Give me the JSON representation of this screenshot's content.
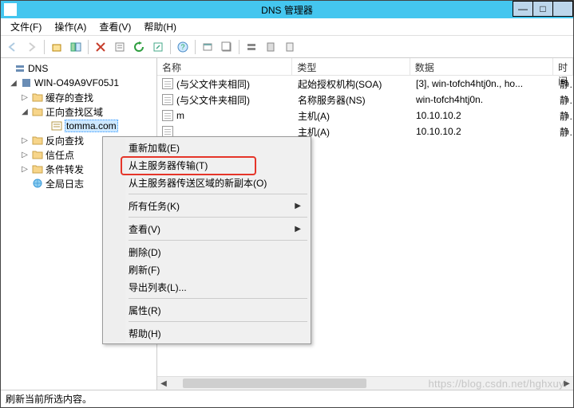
{
  "window": {
    "title": "DNS 管理器",
    "controls": {
      "min": "—",
      "max": "□",
      "close": ""
    }
  },
  "menu": {
    "file": "文件(F)",
    "action": "操作(A)",
    "view": "查看(V)",
    "help": "帮助(H)"
  },
  "tree": {
    "root": "DNS",
    "server": "WIN-O49A9VF05J1",
    "nodes": {
      "cache": "缓存的查找",
      "forward": "正向查找区域",
      "zone_selected": "tomma.com",
      "reverse": "反向查找",
      "trust": "信任点",
      "cond": "条件转发",
      "global": "全局日志"
    }
  },
  "list": {
    "headers": {
      "name": "名称",
      "type": "类型",
      "data": "数据",
      "time": "时间"
    },
    "rows": [
      {
        "name": "(与父文件夹相同)",
        "type": "起始授权机构(SOA)",
        "data": "[3], win-tofch4htj0n., ho...",
        "time": "静态"
      },
      {
        "name": "(与父文件夹相同)",
        "type": "名称服务器(NS)",
        "data": "win-tofch4htj0n.",
        "time": "静态"
      },
      {
        "name": "m",
        "type": "主机(A)",
        "data": "10.10.10.2",
        "time": "静态"
      },
      {
        "name": "",
        "type": "主机(A)",
        "data": "10.10.10.2",
        "time": "静态"
      }
    ]
  },
  "context_menu": {
    "reload": "重新加载(E)",
    "transfer": "从主服务器传输(T)",
    "new_copy": "从主服务器传送区域的新副本(O)",
    "all_tasks": "所有任务(K)",
    "view": "查看(V)",
    "delete": "删除(D)",
    "refresh": "刷新(F)",
    "export": "导出列表(L)...",
    "properties": "属性(R)",
    "help": "帮助(H)"
  },
  "statusbar": {
    "text": "刷新当前所选内容。"
  },
  "watermark": "https://blog.csdn.net/hghxuyi"
}
